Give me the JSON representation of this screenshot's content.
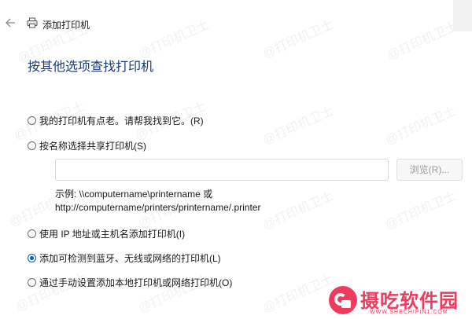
{
  "window": {
    "title": "添加打印机"
  },
  "heading": "按其他选项查找打印机",
  "options": [
    {
      "label": "我的打印机有点老。请帮我找到它。(R)",
      "selected": false
    },
    {
      "label": "按名称选择共享打印机(S)",
      "selected": false
    },
    {
      "label": "使用 IP 地址或主机名添加打印机(I)",
      "selected": false
    },
    {
      "label": "添加可检测到蓝牙、无线或网络的打印机(L)",
      "selected": true
    },
    {
      "label": "通过手动设置添加本地打印机或网络打印机(O)",
      "selected": false
    }
  ],
  "shared_printer": {
    "input_value": "",
    "browse_label": "浏览(R)...",
    "example_line1": "示例: \\\\computername\\printername 或",
    "example_line2": "http://computername/printers/printername/.printer"
  },
  "watermark": "@打印机卫士",
  "brand": {
    "name": "摄吃软件园",
    "url": "WWW.SHECHIPIN1.COM"
  },
  "colors": {
    "heading": "#1e3a7b",
    "accent": "#005fb8",
    "brand": "#ef3b5d"
  },
  "icons": {
    "back": "back-arrow-icon",
    "printer": "printer-icon"
  }
}
